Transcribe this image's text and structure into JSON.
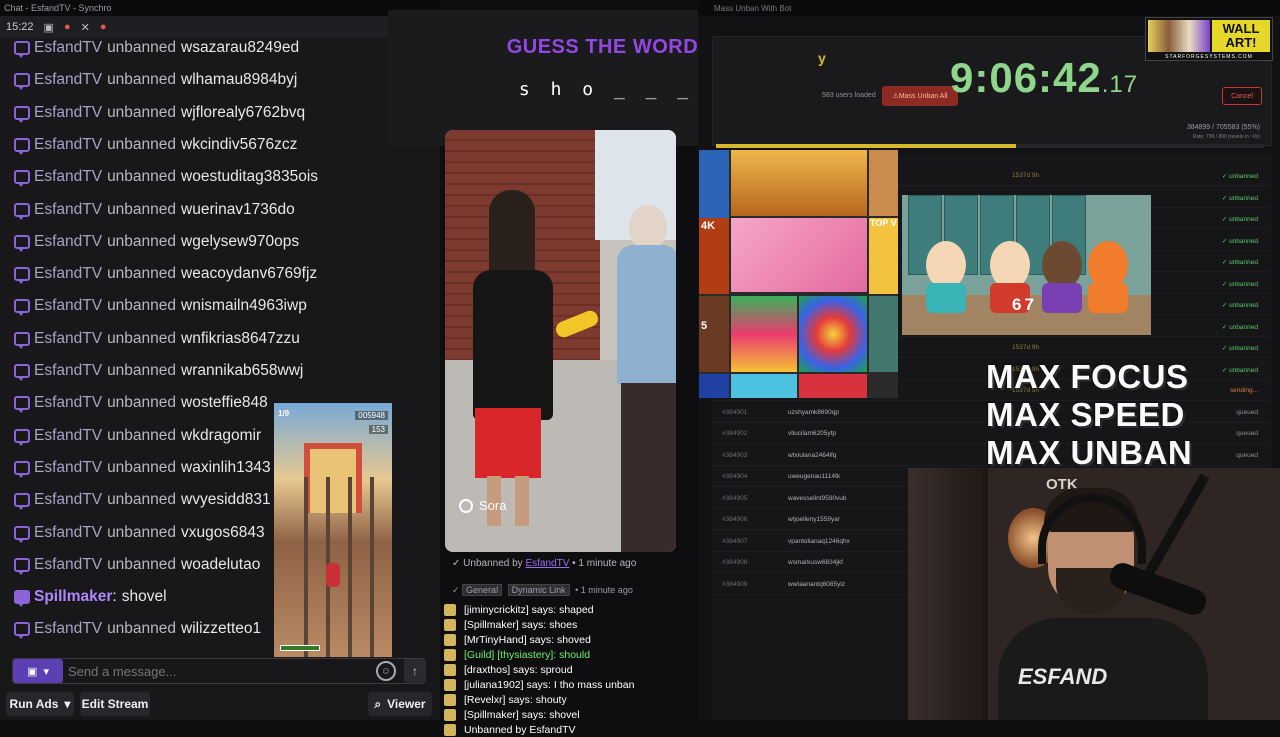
{
  "chat": {
    "titlebar": "Chat - EsfandTV - Synchro",
    "toolbar_time": "15:22",
    "input_placeholder": "Send a message...",
    "run_ads": "Run Ads",
    "edit_stream": "Edit Stream",
    "viewer": "Viewer",
    "messages": [
      {
        "who": "EsfandTV",
        "verb": "unbanned",
        "target": "wsazarau8249ed"
      },
      {
        "who": "EsfandTV",
        "verb": "unbanned",
        "target": "wlhamau8984byj"
      },
      {
        "who": "EsfandTV",
        "verb": "unbanned",
        "target": "wjflorealy6762bvq"
      },
      {
        "who": "EsfandTV",
        "verb": "unbanned",
        "target": "wkcindiv5676zcz"
      },
      {
        "who": "EsfandTV",
        "verb": "unbanned",
        "target": "woestuditag3835ois"
      },
      {
        "who": "EsfandTV",
        "verb": "unbanned",
        "target": "wuerinav1736do"
      },
      {
        "who": "EsfandTV",
        "verb": "unbanned",
        "target": "wgelysew970ops"
      },
      {
        "who": "EsfandTV",
        "verb": "unbanned",
        "target": "weacoydanv6769fjz"
      },
      {
        "who": "EsfandTV",
        "verb": "unbanned",
        "target": "wnismailn4963iwp"
      },
      {
        "who": "EsfandTV",
        "verb": "unbanned",
        "target": "wnfikrias8647zzu"
      },
      {
        "who": "EsfandTV",
        "verb": "unbanned",
        "target": "wrannikab658wwj"
      },
      {
        "who": "EsfandTV",
        "verb": "unbanned",
        "target": "wosteffie848"
      },
      {
        "who": "EsfandTV",
        "verb": "unbanned",
        "target": "wkdragomir"
      },
      {
        "who": "EsfandTV",
        "verb": "unbanned",
        "target": "waxinlih1343"
      },
      {
        "who": "EsfandTV",
        "verb": "unbanned",
        "target": "wvyesidd831"
      },
      {
        "who": "EsfandTV",
        "verb": "unbanned",
        "target": "vxugos6843"
      },
      {
        "who": "EsfandTV",
        "verb": "unbanned",
        "target": "woadelutao"
      },
      {
        "who": "Spillmaker",
        "verb": ":",
        "target": "shovel"
      },
      {
        "who": "EsfandTV",
        "verb": "unbanned",
        "target": "wilizzetteo1"
      }
    ]
  },
  "game": {
    "hud": "1/9",
    "score": "005948",
    "coins": "153"
  },
  "guess": {
    "title": "GUESS THE WORD!",
    "word": "sho___"
  },
  "video": {
    "watermark": "Sora"
  },
  "log": {
    "unbanned_prefix": "Unbanned by",
    "unbanned_by": "EsfandTV",
    "ago": "• 1 minute ago",
    "tags": [
      "General",
      "Dynamic Link"
    ],
    "says": [
      {
        "text": "[jiminycrickitz] says: shaped",
        "style": "normal"
      },
      {
        "text": "[Spillmaker] says: shoes",
        "style": "normal"
      },
      {
        "text": "[MrTinyHand] says: shoved",
        "style": "normal"
      },
      {
        "text": "[Guild] [thysiastery]: should",
        "style": "guild"
      },
      {
        "text": "[draxthos] says: sproud",
        "style": "normal"
      },
      {
        "text": "[juliana1902] says: I tho mass unban",
        "style": "normal"
      },
      {
        "text": "[Revelxr] says: shouty",
        "style": "normal"
      },
      {
        "text": "[Spillmaker] says: shovel",
        "style": "normal"
      },
      {
        "text": "Unbanned by EsfandTV",
        "style": "normal"
      }
    ]
  },
  "mass_unban": {
    "titlebar": "Mass Unban With Bot",
    "title_fragment": "y",
    "users_loaded": "583 users loaded",
    "mass_unban_button": "Mass Unban All",
    "cancel_button": "Cancel",
    "progress_text": "384899 / 705583 (55%)",
    "rate_text": "Rate: 799 / 800 (resets in ~0s)",
    "progress": 0.55,
    "rows": [
      {
        "id": "",
        "name": "",
        "ts": "1537d 9h",
        "status": "unbanned"
      },
      {
        "id": "",
        "name": "",
        "ts": "",
        "status": "unbanned"
      },
      {
        "id": "",
        "name": "",
        "ts": "",
        "status": "unbanned"
      },
      {
        "id": "",
        "name": "",
        "ts": "",
        "status": "unbanned"
      },
      {
        "id": "",
        "name": "",
        "ts": "",
        "status": "unbanned"
      },
      {
        "id": "",
        "name": "",
        "ts": "",
        "status": "unbanned"
      },
      {
        "id": "",
        "name": "",
        "ts": "",
        "status": "unbanned"
      },
      {
        "id": "",
        "name": "",
        "ts": "",
        "status": "unbanned"
      },
      {
        "id": "",
        "name": "",
        "ts": "1537d 9h",
        "status": "unbanned"
      },
      {
        "id": "",
        "name": "",
        "ts": "1537d 9h",
        "status": "unbanned"
      },
      {
        "id": "",
        "name": "",
        "ts": "1537d 9h",
        "status": "sending..."
      },
      {
        "id": "#384901",
        "name": "uzshyamk8690qp",
        "ts": "",
        "status": "queued"
      },
      {
        "id": "#384902",
        "name": "vllucilam6205ytp",
        "ts": "",
        "status": "queued"
      },
      {
        "id": "#384903",
        "name": "wtxiulana2464lfq",
        "ts": "",
        "status": "queued"
      },
      {
        "id": "#384904",
        "name": "uweugenau1114tk",
        "ts": "",
        "status": "queued"
      },
      {
        "id": "#384905",
        "name": "wavesselint9590vub",
        "ts": "",
        "status": ""
      },
      {
        "id": "#384906",
        "name": "wtjoelleny1559yar",
        "ts": "",
        "status": ""
      },
      {
        "id": "#384907",
        "name": "vpantolianaq1246qhx",
        "ts": "",
        "status": ""
      },
      {
        "id": "#384908",
        "name": "wsmarkusw6834jkf",
        "ts": "",
        "status": ""
      },
      {
        "id": "#384909",
        "name": "wwtaanantq6085ylz",
        "ts": "",
        "status": ""
      }
    ]
  },
  "timer": {
    "main": "9:06:42",
    "ms": ".17"
  },
  "wallart": {
    "line1": "WALL",
    "line2": "ART!",
    "sub": "STARFORGESYSTEMS.COM"
  },
  "collage": {
    "label_4k": "4K",
    "label_top": "TOP V",
    "label_s": "5"
  },
  "southpark": {
    "number": "67"
  },
  "overlay": {
    "line1": "MAX FOCUS",
    "line2": "MAX SPEED",
    "line3": "MAX UNBAN"
  },
  "cam": {
    "shirt": "ESFAND",
    "logo": "OTK"
  },
  "colors": {
    "accent_purple": "#9447e6",
    "unbanned_green": "#5cc86a",
    "timer_green": "#8fd58b",
    "danger_red": "#c73a2e"
  }
}
